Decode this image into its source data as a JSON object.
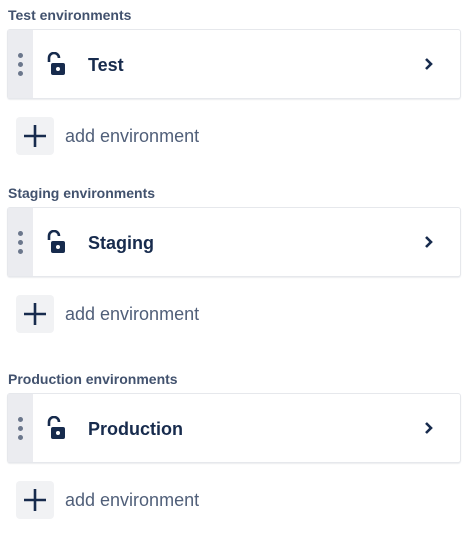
{
  "sections": [
    {
      "header": "Test environments",
      "environment": {
        "name": "Test",
        "icon": "unlock-icon"
      },
      "add_label": "add environment"
    },
    {
      "header": "Staging environments",
      "environment": {
        "name": "Staging",
        "icon": "unlock-icon"
      },
      "add_label": "add environment"
    },
    {
      "header": "Production environments",
      "environment": {
        "name": "Production",
        "icon": "unlock-icon"
      },
      "add_label": "add environment"
    }
  ]
}
